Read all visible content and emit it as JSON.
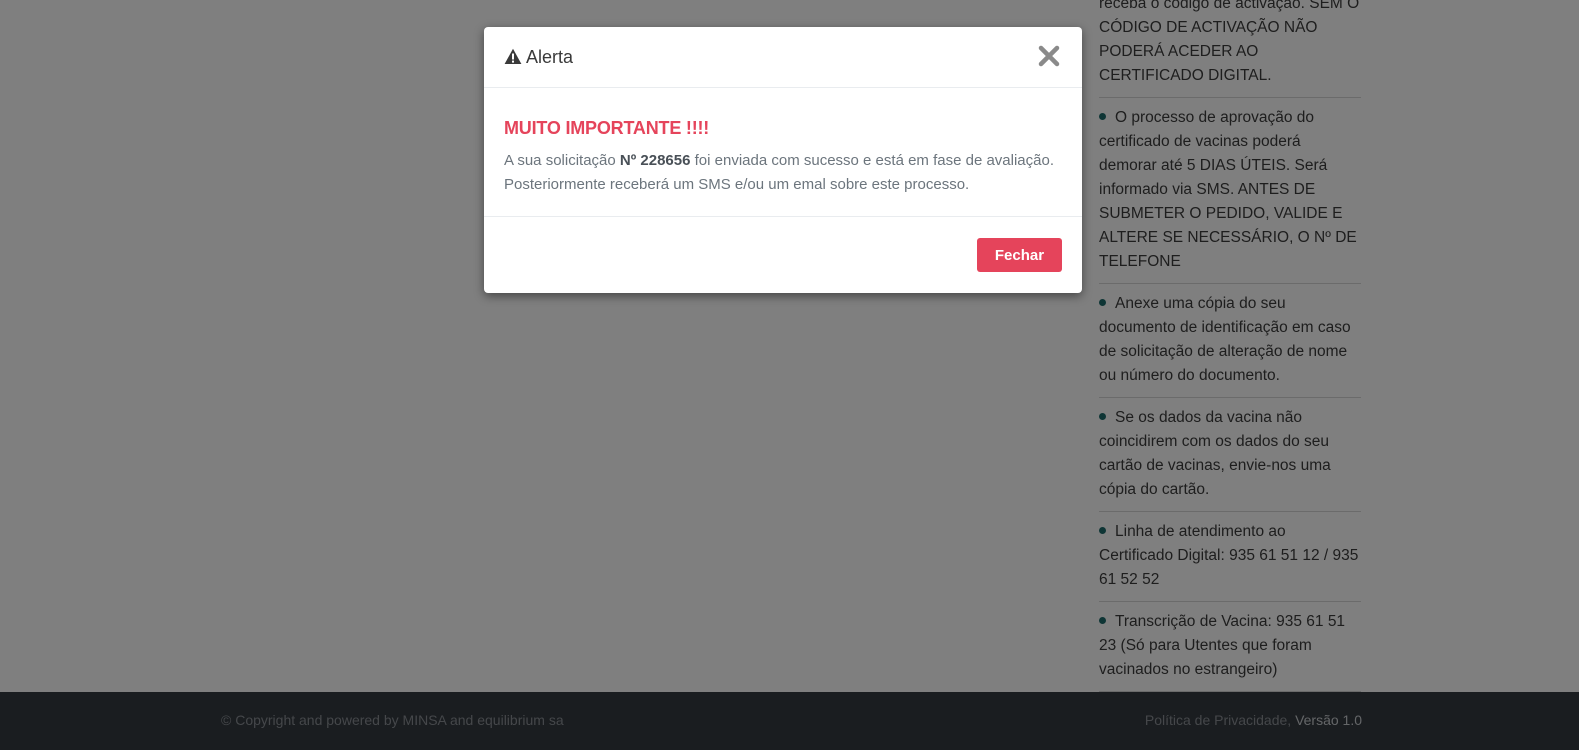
{
  "sidebar": {
    "items": [
      {
        "text": "receba o código de activação. SEM O CÓDIGO DE ACTIVAÇÃO NÃO PODERÁ ACEDER AO CERTIFICADO DIGITAL."
      },
      {
        "text": "O processo de aprovação do certificado de vacinas poderá demorar até 5 DIAS ÚTEIS. Será informado via SMS. ANTES DE SUBMETER O PEDIDO, VALIDE E ALTERE SE NECESSÁRIO, O Nº DE TELEFONE"
      },
      {
        "text": "Anexe uma cópia do seu documento de identificação em caso de solicitação de alteração de nome ou número do documento."
      },
      {
        "text": "Se os dados da vacina não coincidirem com os dados do seu cartão de vacinas, envie-nos uma cópia do cartão."
      },
      {
        "text": "Linha de atendimento ao Certificado Digital: 935 61 51 12 / 935 61 52 52"
      },
      {
        "text": "Transcrição de Vacina: 935 61 51 23 (Só para Utentes que foram vacinados no estrangeiro)"
      }
    ]
  },
  "footer": {
    "copyright": "© Copyright and powered by MINSA and equilibrium sa",
    "privacy_link": "Política de Privacidade",
    "separator": ",",
    "version": "Versão 1.0"
  },
  "modal": {
    "title": "Alerta",
    "icon": "warning-icon",
    "close_icon": "close-icon",
    "heading": "MUITO IMPORTANTE !!!!",
    "message_before": "A sua solicitação",
    "request_number": "Nº 228656",
    "message_after": "foi enviada com sucesso e está em fase de avaliação. Posteriormente receberá um SMS e/ou um emal sobre este processo.",
    "button_label": "Fechar"
  },
  "colors": {
    "accent": "#e5445b",
    "footer_bg": "#343a40",
    "bullet": "#1d6b6b"
  }
}
